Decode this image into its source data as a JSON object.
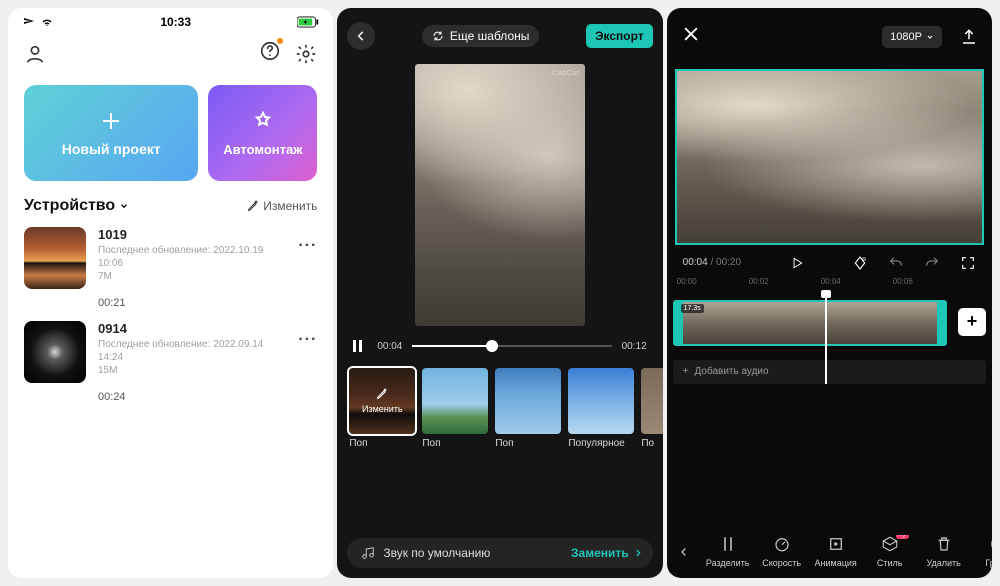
{
  "statusbar": {
    "time": "10:33"
  },
  "home": {
    "new_project": "Новый проект",
    "automontage": "Автомонтаж",
    "device_header": "Устройство",
    "edit_label": "Изменить",
    "projects": [
      {
        "name": "1019",
        "updated_prefix": "Последнее обновление:",
        "updated": "2022.10.19 10:06",
        "size": "7M",
        "duration": "00:21"
      },
      {
        "name": "0914",
        "updated_prefix": "Последнее обновление:",
        "updated": "2022.09.14 14:24",
        "size": "15M",
        "duration": "00:24"
      }
    ]
  },
  "template": {
    "more_templates": "Еще шаблоны",
    "export": "Экспорт",
    "watermark": "CapCut",
    "current_time": "00:04",
    "total_time": "00:12",
    "progress_pct": 40,
    "edit_chip": "Изменить",
    "items": [
      {
        "label": "Поп"
      },
      {
        "label": "Поп"
      },
      {
        "label": "Поп"
      },
      {
        "label": "Популярное"
      },
      {
        "label": "По"
      }
    ],
    "audio_label": "Звук по умолчанию",
    "replace": "Заменить"
  },
  "editor": {
    "resolution": "1080P",
    "current": "00:04",
    "total": "00:20",
    "ruler": [
      "00:00",
      "00:02",
      "00:04",
      "00:06"
    ],
    "clip_duration": "17.3s",
    "add_audio": "Добавить аудио",
    "tools": {
      "split": "Разделить",
      "speed": "Скорость",
      "animation": "Анимация",
      "style": "Стиль",
      "style_badge": "try",
      "delete": "Удалить",
      "volume": "Громк"
    }
  },
  "colors": {
    "accent": "#1ec6b6"
  }
}
